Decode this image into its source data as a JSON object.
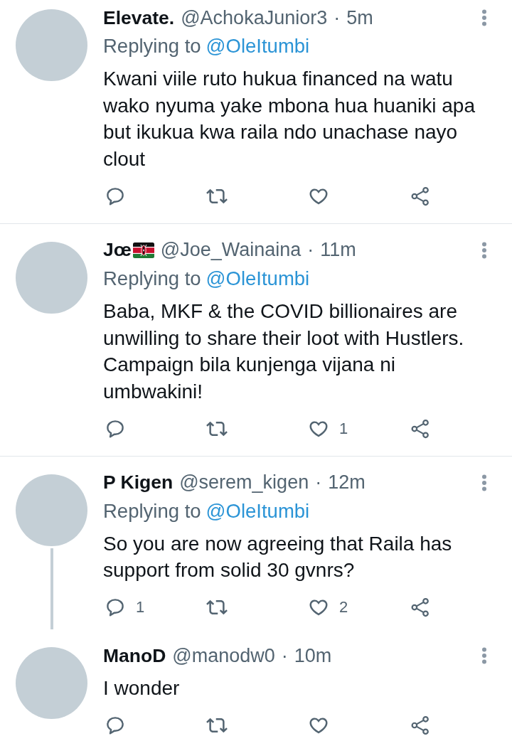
{
  "tweets": [
    {
      "name": "Elevate.",
      "flag": false,
      "handle": "@AchokaJunior3",
      "separator": "·",
      "time": "5m",
      "replying_label": "Replying to",
      "replying_to": "@OleItumbi",
      "text": "Kwani viile ruto hukua financed na watu wako nyuma yake mbona hua huaniki apa but ikukua kwa raila ndo unachase nayo clout",
      "thread_continues": false,
      "actions": [
        {
          "kind": "reply"
        },
        {
          "kind": "retweet"
        },
        {
          "kind": "like"
        },
        {
          "kind": "share"
        }
      ]
    },
    {
      "name": "Jœ",
      "flag": true,
      "handle": "@Joe_Wainaina",
      "separator": "·",
      "time": "11m",
      "replying_label": "Replying to",
      "replying_to": "@OleItumbi",
      "text": "Baba, MKF & the COVID billionaires are unwilling to share their loot with Hustlers. Campaign bila kunjenga vijana ni umbwakini!",
      "thread_continues": false,
      "actions": [
        {
          "kind": "reply"
        },
        {
          "kind": "retweet"
        },
        {
          "kind": "like",
          "count": "1"
        },
        {
          "kind": "share"
        }
      ]
    },
    {
      "name": "P Kigen",
      "flag": false,
      "handle": "@serem_kigen",
      "separator": "·",
      "time": "12m",
      "replying_label": "Replying to",
      "replying_to": "@OleItumbi",
      "text": "So you are now agreeing that Raila has support from solid 30 gvnrs?",
      "thread_continues": true,
      "actions": [
        {
          "kind": "reply",
          "count": "1"
        },
        {
          "kind": "retweet"
        },
        {
          "kind": "like",
          "count": "2"
        },
        {
          "kind": "share"
        }
      ]
    },
    {
      "name": "ManoD",
      "flag": false,
      "handle": "@manodw0",
      "separator": "·",
      "time": "10m",
      "text": "I wonder",
      "thread_continues": false,
      "actions": [
        {
          "kind": "reply"
        },
        {
          "kind": "retweet"
        },
        {
          "kind": "like"
        },
        {
          "kind": "share"
        }
      ]
    }
  ]
}
